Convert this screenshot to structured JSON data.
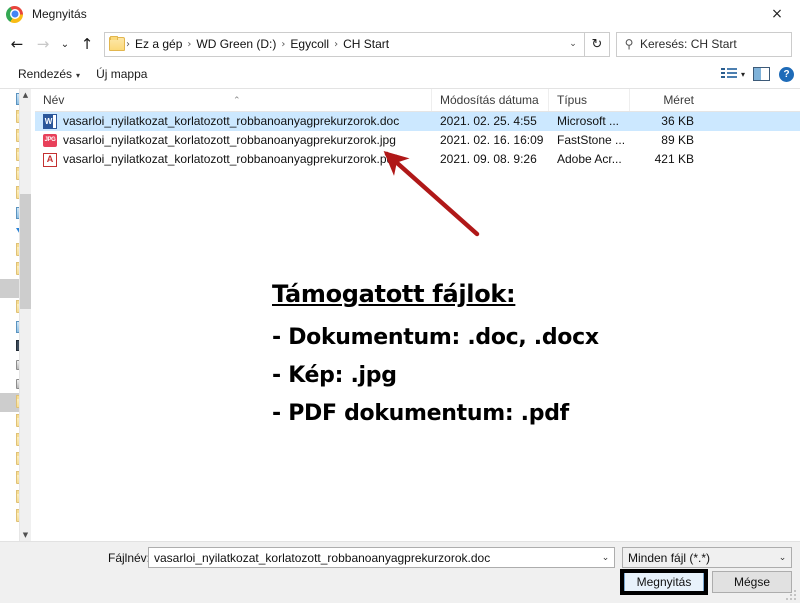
{
  "window": {
    "title": "Megnyitás",
    "app_icon": "chrome-icon",
    "close_label": "×"
  },
  "nav": {
    "back_label": "←",
    "forward_label": "→",
    "history_label": "⌄",
    "up_label": "↑",
    "refresh_label": "↻",
    "dropdown_label": "⌄",
    "breadcrumbs": [
      {
        "label": "Ez a gép"
      },
      {
        "label": "WD Green (D:)"
      },
      {
        "label": "Egycoll"
      },
      {
        "label": "CH Start"
      }
    ],
    "separator": "›"
  },
  "search": {
    "icon": "search-icon",
    "placeholder": "Keresés: CH Start"
  },
  "toolbar": {
    "sort_label": "Rendezés",
    "sort_caret": "▾",
    "new_folder_label": "Új mappa",
    "view_caret": "▾",
    "help_label": "?"
  },
  "columns": {
    "name": "Név",
    "date": "Módosítás dátuma",
    "type": "Típus",
    "size": "Méret",
    "sort_indicator": "⌃"
  },
  "files": [
    {
      "icon": "word-document-icon",
      "icon_label": "W",
      "name": "vasarloi_nyilatkozat_korlatozott_robbanoanyagprekurzorok.doc",
      "date": "2021. 02. 25. 4:55",
      "type": "Microsoft ...",
      "size": "36 KB",
      "selected": true
    },
    {
      "icon": "jpg-image-icon",
      "icon_label": "JPG",
      "name": "vasarloi_nyilatkozat_korlatozott_robbanoanyagprekurzorok.jpg",
      "date": "2021. 02. 16. 16:09",
      "type": "FastStone ...",
      "size": "89 KB",
      "selected": false
    },
    {
      "icon": "pdf-document-icon",
      "icon_label": "A",
      "name": "vasarloi_nyilatkozat_korlatozott_robbanoanyagprekurzorok.pdf",
      "date": "2021. 09. 08. 9:26",
      "type": "Adobe Acr...",
      "size": "421 KB",
      "selected": false
    }
  ],
  "annotation": {
    "title": "Támogatott fájlok:",
    "lines": [
      "- Dokumentum: .doc, .docx",
      "- Kép: .jpg",
      "- PDF dokumentum: .pdf"
    ],
    "arrow_color": "#b01818",
    "highlight_color": "#000000"
  },
  "footer": {
    "filename_label": "Fájlnév:",
    "filename_value": "vasarloi_nyilatkozat_korlatozott_robbanoanyagprekurzorok.doc",
    "filetype_value": "Minden fájl (*.*)",
    "caret": "⌄",
    "open_label": "Megnyitás",
    "cancel_label": "Mégse"
  },
  "colors": {
    "selection": "#cce8ff",
    "accent": "#1e6bb8",
    "chrome_blue": "#4285f4"
  }
}
